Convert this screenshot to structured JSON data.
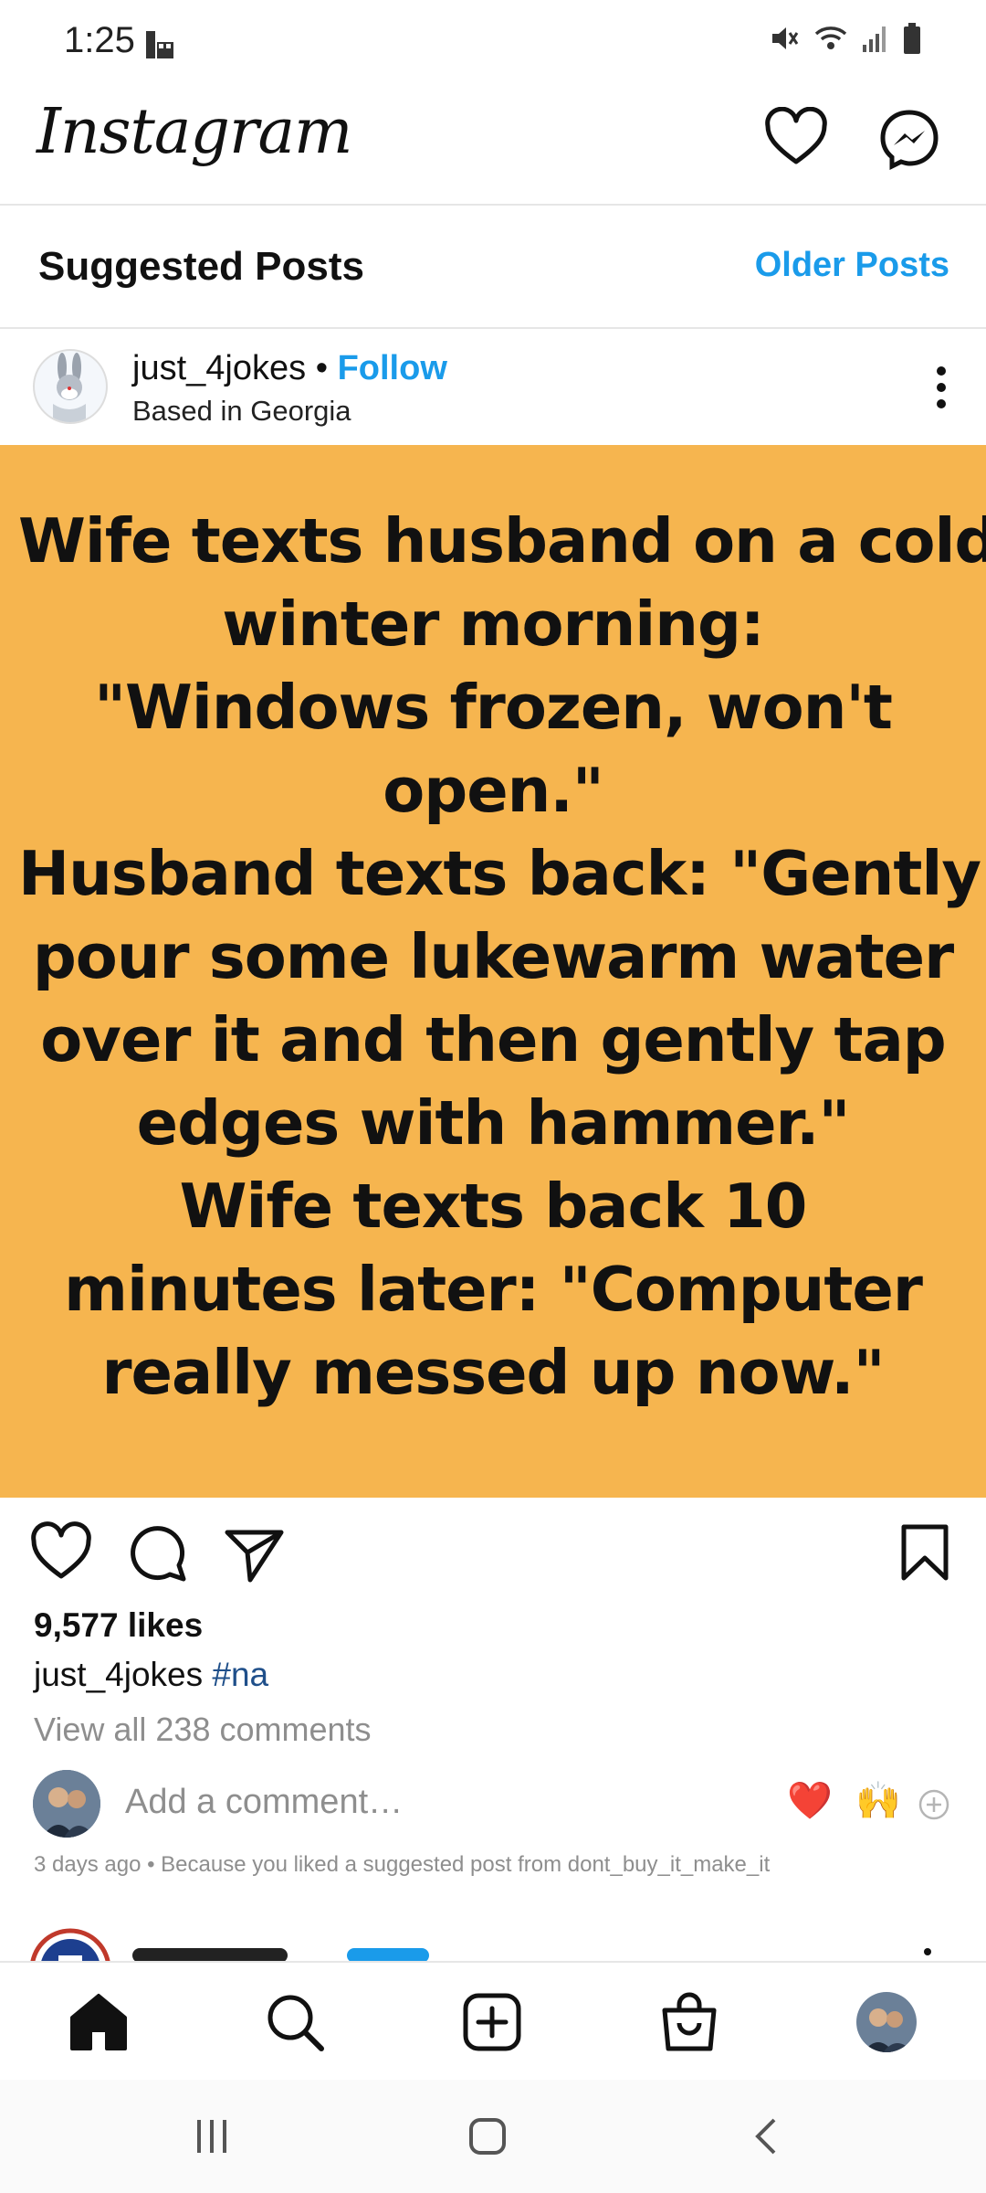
{
  "status_bar": {
    "time": "1:25"
  },
  "header": {
    "logo_text": "Instagram"
  },
  "suggested": {
    "title": "Suggested Posts",
    "older_label": "Older Posts"
  },
  "post": {
    "username": "just_4jokes",
    "separator": "•",
    "follow_label": "Follow",
    "location": "Based in Georgia",
    "image_text_lines": [
      "Wife texts husband on a cold",
      "winter morning:",
      "\"Windows frozen, won't",
      "open.\"",
      "Husband texts back: \"Gently",
      "pour some lukewarm water",
      "over it and then gently tap",
      "edges with hammer.\"",
      "Wife texts back 10",
      "minutes later: \"Computer",
      "really messed up now.\""
    ],
    "likes": "9,577 likes",
    "caption_user": "just_4jokes",
    "caption_tag": "#na",
    "view_comments": "View all 238 comments",
    "comment_placeholder": "Add a comment…",
    "reactions": [
      "❤️",
      "🙌"
    ],
    "meta": "3 days ago • Because you liked a suggested post from dont_buy_it_make_it"
  },
  "icons": {
    "status": [
      "media-icon",
      "mute-icon",
      "wifi-icon",
      "signal-icon",
      "battery-icon"
    ],
    "header": [
      "heart-icon",
      "messenger-icon"
    ],
    "actions": [
      "like-icon",
      "comment-icon",
      "share-icon",
      "bookmark-icon"
    ],
    "bottom_nav": [
      "home-icon",
      "search-icon",
      "create-icon",
      "shop-icon",
      "profile-icon"
    ],
    "system_nav": [
      "recents-icon",
      "home-button-icon",
      "back-icon"
    ]
  },
  "colors": {
    "accent": "#1a9bea",
    "post_background": "#f6b54f",
    "text": "#262626",
    "muted": "#8e8e8e"
  }
}
